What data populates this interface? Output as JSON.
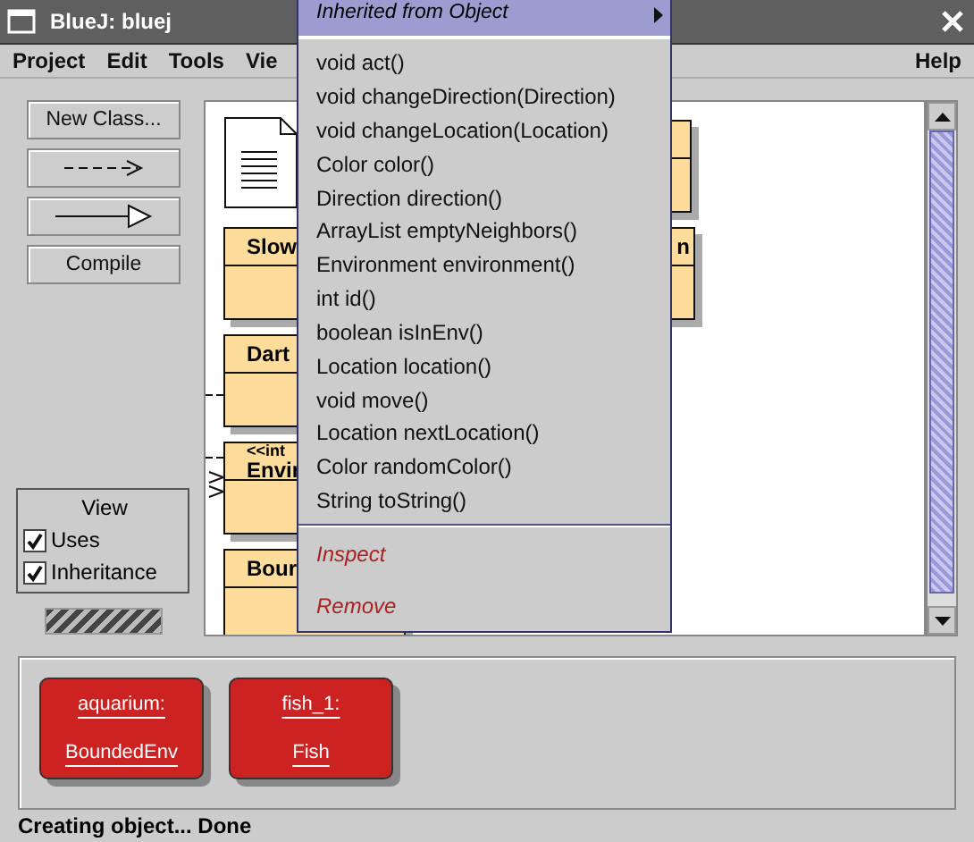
{
  "window": {
    "title": "BlueJ:  bluej"
  },
  "menubar": {
    "items": [
      "Project",
      "Edit",
      "Tools",
      "Vie"
    ],
    "help": "Help"
  },
  "tool_buttons": [
    {
      "kind": "text",
      "label": "New Class..."
    },
    {
      "kind": "uses"
    },
    {
      "kind": "inherits"
    },
    {
      "kind": "text",
      "label": "Compile"
    }
  ],
  "view_panel": {
    "title": "View",
    "options": [
      {
        "label": "Uses",
        "checked": true
      },
      {
        "label": "Inheritance",
        "checked": true
      }
    ]
  },
  "diagram": {
    "nodes": [
      {
        "kind": "document"
      },
      {
        "kind": "class",
        "name": "Slow"
      },
      {
        "kind": "class",
        "name": "Dart"
      },
      {
        "kind": "class",
        "stereotype": "<<int",
        "name": "Envir"
      },
      {
        "kind": "class",
        "name": "Bour"
      },
      {
        "kind": "class"
      },
      {
        "kind": "class",
        "name": "n"
      }
    ]
  },
  "popup_menu": {
    "header": "Inherited from Object",
    "items": [
      {
        "kind": "method",
        "label": "void act()"
      },
      {
        "kind": "method",
        "label": "void changeDirection(Direction)"
      },
      {
        "kind": "method",
        "label": "void changeLocation(Location)"
      },
      {
        "kind": "method",
        "label": "Color color()"
      },
      {
        "kind": "method",
        "label": "Direction direction()"
      },
      {
        "kind": "method",
        "label": "ArrayList emptyNeighbors()"
      },
      {
        "kind": "method",
        "label": "Environment environment()"
      },
      {
        "kind": "method",
        "label": "int id()"
      },
      {
        "kind": "method",
        "label": "boolean isInEnv()"
      },
      {
        "kind": "method",
        "label": "Location location()"
      },
      {
        "kind": "method",
        "label": "void move()"
      },
      {
        "kind": "method",
        "label": "Location nextLocation()"
      },
      {
        "kind": "method",
        "label": "Color randomColor()"
      },
      {
        "kind": "method",
        "label": "String toString()"
      },
      {
        "kind": "separator"
      },
      {
        "kind": "action",
        "label": "Inspect"
      },
      {
        "kind": "action",
        "label": "Remove"
      }
    ]
  },
  "object_bench": [
    {
      "name": "aquarium:",
      "type": "BoundedEnv"
    },
    {
      "name": "fish_1:",
      "type": "Fish"
    }
  ],
  "status_bar": "Creating object... Done"
}
